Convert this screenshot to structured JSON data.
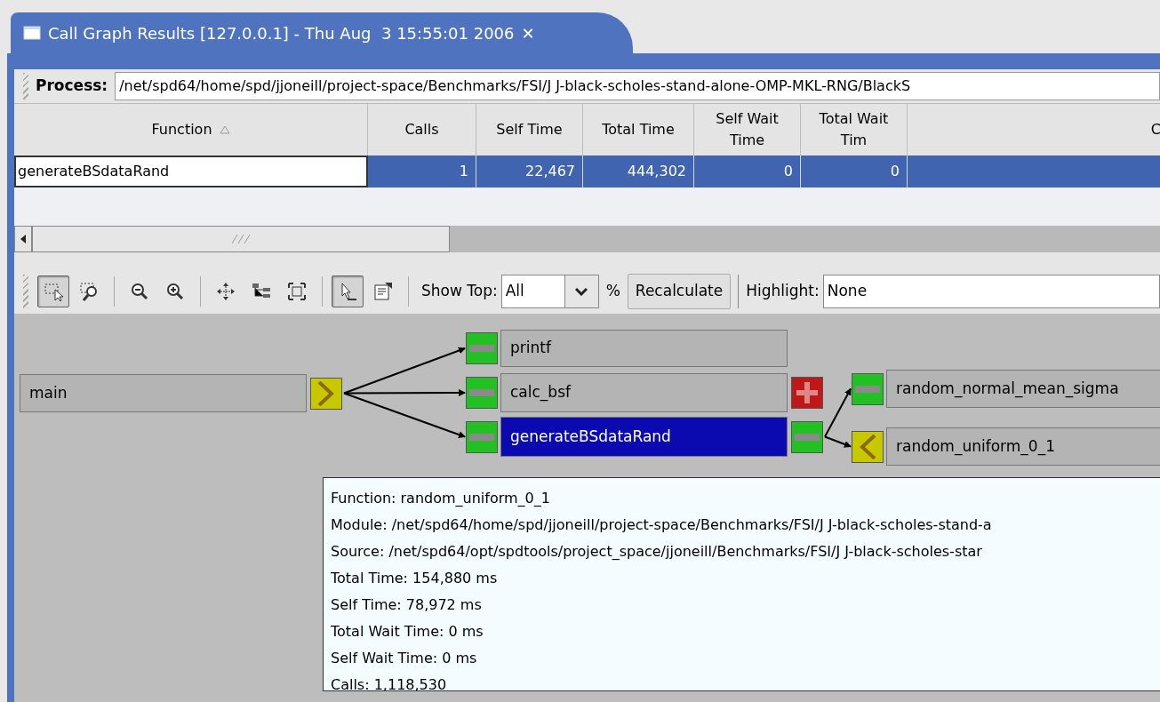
{
  "tab": {
    "title": "Call Graph Results [127.0.0.1] - Thu Aug  3 15:55:01 2006",
    "close": "✕"
  },
  "process": {
    "label": "Process:",
    "value": "/net/spd64/home/spd/jjoneill/project-space/Benchmarks/FSI/J J-black-scholes-stand-alone-OMP-MKL-RNG/BlackS"
  },
  "table": {
    "columns": [
      {
        "label": "Function",
        "sorted": true
      },
      {
        "label": "Calls",
        "sorted": false
      },
      {
        "label": "Self Time",
        "sorted": false
      },
      {
        "label": "Total Time",
        "sorted": false
      },
      {
        "label": "Self Wait Time",
        "sorted": false
      },
      {
        "label": "Total Wait Tim",
        "sorted": false
      },
      {
        "label": "C",
        "sorted": false
      }
    ],
    "rows": [
      {
        "selected": true,
        "cells": [
          "generateBSdataRand",
          "1",
          "22,467",
          "444,302",
          "0",
          "0",
          ""
        ]
      }
    ]
  },
  "toolbar": {
    "tools": [
      {
        "kind": "select",
        "pressed": true
      },
      {
        "kind": "zoom_area",
        "pressed": false
      },
      {
        "kind": "zoom_out",
        "pressed": false
      },
      {
        "kind": "zoom_in",
        "pressed": false
      },
      {
        "kind": "move",
        "pressed": false
      },
      {
        "kind": "tree",
        "pressed": false
      },
      {
        "kind": "fit",
        "pressed": false
      },
      {
        "kind": "pointer",
        "pressed": true
      },
      {
        "kind": "properties",
        "pressed": false
      }
    ],
    "show_top_label": "Show Top:",
    "show_top_value": "All",
    "percent": "%",
    "recalculate": "Recalculate",
    "highlight_label": "Highlight:",
    "highlight_value": "None"
  },
  "graph": {
    "nodes": [
      {
        "label": "main",
        "selected": false,
        "right_button": {
          "kind": "expand_right"
        }
      },
      {
        "label": "printf",
        "selected": false,
        "left_button": {
          "kind": "minus"
        }
      },
      {
        "label": "calc_bsf",
        "selected": false,
        "left_button": {
          "kind": "minus"
        },
        "right_button": {
          "kind": "plus"
        }
      },
      {
        "label": "generateBSdataRand",
        "selected": true,
        "left_button": {
          "kind": "minus"
        },
        "right_button": {
          "kind": "minus"
        }
      },
      {
        "label": "random_normal_mean_sigma",
        "selected": false,
        "left_button": {
          "kind": "minus"
        }
      },
      {
        "label": "random_uniform_0_1",
        "selected": false,
        "left_button": {
          "kind": "expand_left"
        }
      }
    ]
  },
  "tooltip": {
    "lines": [
      "Function: random_uniform_0_1",
      "Module: /net/spd64/home/spd/jjoneill/project-space/Benchmarks/FSI/J J-black-scholes-stand-a",
      "Source: /net/spd64/opt/spdtools/project_space/jjoneill/Benchmarks/FSI/J J-black-scholes-star",
      "Total Time: 154,880 ms",
      "Self Time: 78,972 ms",
      "Total Wait Time: 0 ms",
      "Self Wait Time: 0 ms",
      "Calls: 1,118,530"
    ]
  }
}
